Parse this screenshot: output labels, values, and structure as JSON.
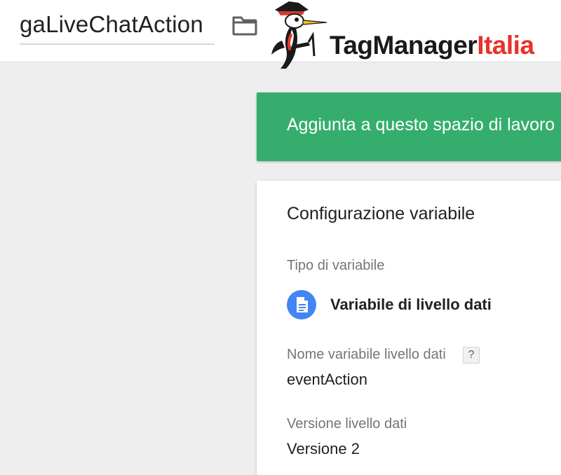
{
  "header": {
    "variable_name": "gaLiveChatAction",
    "folder_icon": "folder-icon",
    "brand": {
      "part1": "TagManager",
      "part2": "Italia",
      "mascot": "woodpecker-mascot-logo",
      "colors": {
        "part1": "#1a1a1a",
        "part2": "#e8322b"
      }
    }
  },
  "banner": {
    "text": "Aggiunta a questo spazio di lavoro",
    "color": "#35ae6d"
  },
  "config": {
    "title": "Configurazione variabile",
    "type_label": "Tipo di variabile",
    "type_icon": "document-icon",
    "type_value": "Variabile di livello dati",
    "name_label": "Nome variabile livello dati",
    "help": "?",
    "name_value": "eventAction",
    "version_label": "Versione livello dati",
    "version_value": "Versione 2"
  }
}
